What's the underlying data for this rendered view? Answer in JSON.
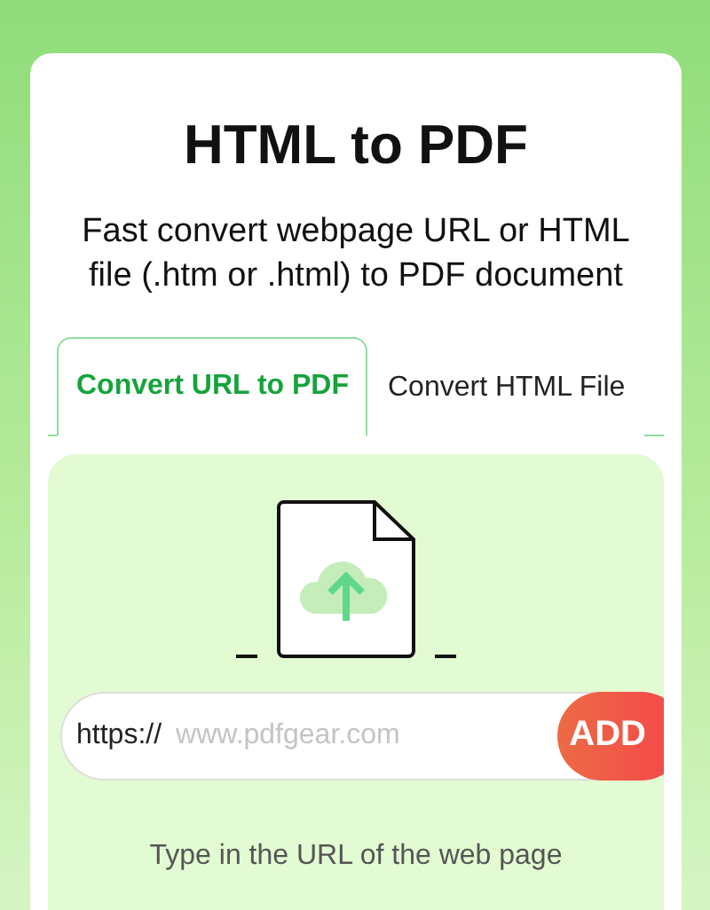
{
  "title": "HTML to PDF",
  "subtitle": "Fast convert webpage URL or HTML file (.htm or .html) to PDF document",
  "tabs": [
    {
      "label": "Convert URL to PDF",
      "selected": true
    },
    {
      "label": "Convert HTML File",
      "selected": false
    }
  ],
  "url_field": {
    "prefix": "https://",
    "placeholder": "www.pdfgear.com"
  },
  "add_button": "ADD",
  "hint": "Type in the URL of the web page"
}
